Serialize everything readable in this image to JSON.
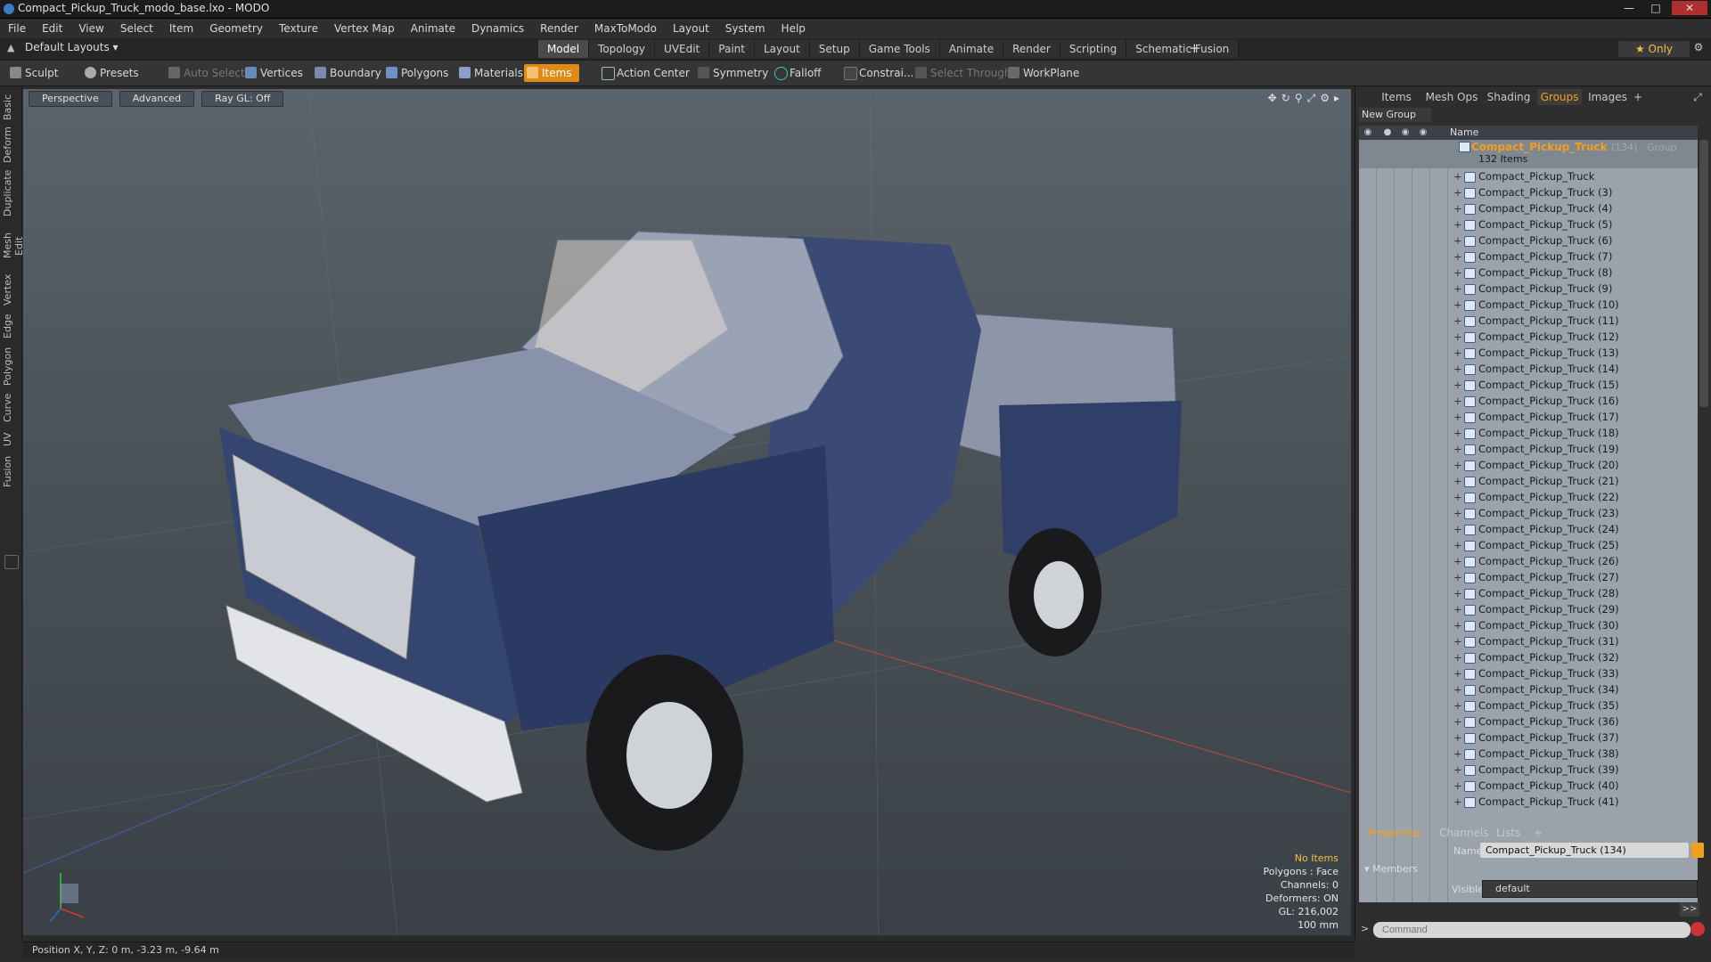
{
  "window": {
    "title": "Compact_Pickup_Truck_modo_base.lxo - MODO"
  },
  "menu": [
    "File",
    "Edit",
    "View",
    "Select",
    "Item",
    "Geometry",
    "Texture",
    "Vertex Map",
    "Animate",
    "Dynamics",
    "Render",
    "MaxToModo",
    "Layout",
    "System",
    "Help"
  ],
  "layouts": {
    "label": "Default Layouts ▾"
  },
  "tabs": [
    "Model",
    "Topology",
    "UVEdit",
    "Paint",
    "Layout",
    "Setup",
    "Game Tools",
    "Animate",
    "Render",
    "Scripting",
    "Schematic Fusion"
  ],
  "only_label": "★ Only",
  "toolbar": {
    "sculpt": "Sculpt",
    "presets": "Presets",
    "auto_select": "Auto Select",
    "vertices": "Vertices",
    "boundary": "Boundary",
    "polygons": "Polygons",
    "materials": "Materials",
    "items": "Items",
    "action_center": "Action Center",
    "symmetry": "Symmetry",
    "falloff": "Falloff",
    "constraints": "Constrai...",
    "select_through": "Select Through",
    "workplane": "WorkPlane"
  },
  "side_tabs": [
    "Basic",
    "Deform",
    "Duplicate",
    "Mesh Edit",
    "Vertex",
    "Edge",
    "Polygon",
    "Curve",
    "UV",
    "Fusion"
  ],
  "viewport": {
    "perspective": "Perspective",
    "advanced": "Advanced",
    "raygl": "Ray GL: Off",
    "hud": {
      "items": "No Items",
      "polygons": "Polygons : Face",
      "channels": "Channels: 0",
      "deformers": "Deformers: ON",
      "gl": "GL: 216,002",
      "unit": "100 mm"
    }
  },
  "panel_tabs": [
    "Items",
    "Mesh Ops",
    "Shading",
    "Groups",
    "Images"
  ],
  "new_group": "New Group",
  "tree_header": "Name",
  "group": {
    "name": "Compact_Pickup_Truck",
    "suffix": "(134) : Group",
    "count": "132 Items"
  },
  "tree_items": [
    "Compact_Pickup_Truck",
    "Compact_Pickup_Truck (3)",
    "Compact_Pickup_Truck (4)",
    "Compact_Pickup_Truck (5)",
    "Compact_Pickup_Truck (6)",
    "Compact_Pickup_Truck (7)",
    "Compact_Pickup_Truck (8)",
    "Compact_Pickup_Truck (9)",
    "Compact_Pickup_Truck (10)",
    "Compact_Pickup_Truck (11)",
    "Compact_Pickup_Truck (12)",
    "Compact_Pickup_Truck (13)",
    "Compact_Pickup_Truck (14)",
    "Compact_Pickup_Truck (15)",
    "Compact_Pickup_Truck (16)",
    "Compact_Pickup_Truck (17)",
    "Compact_Pickup_Truck (18)",
    "Compact_Pickup_Truck (19)",
    "Compact_Pickup_Truck (20)",
    "Compact_Pickup_Truck (21)",
    "Compact_Pickup_Truck (22)",
    "Compact_Pickup_Truck (23)",
    "Compact_Pickup_Truck (24)",
    "Compact_Pickup_Truck (25)",
    "Compact_Pickup_Truck (26)",
    "Compact_Pickup_Truck (27)",
    "Compact_Pickup_Truck (28)",
    "Compact_Pickup_Truck (29)",
    "Compact_Pickup_Truck (30)",
    "Compact_Pickup_Truck (31)",
    "Compact_Pickup_Truck (32)",
    "Compact_Pickup_Truck (33)",
    "Compact_Pickup_Truck (34)",
    "Compact_Pickup_Truck (35)",
    "Compact_Pickup_Truck (36)",
    "Compact_Pickup_Truck (37)",
    "Compact_Pickup_Truck (38)",
    "Compact_Pickup_Truck (39)",
    "Compact_Pickup_Truck (40)",
    "Compact_Pickup_Truck (41)"
  ],
  "props": {
    "tabs": [
      "Properties",
      "Channels",
      "Lists"
    ],
    "name_label": "Name",
    "name_value": "Compact_Pickup_Truck (134)",
    "members": "Members",
    "visible_label": "Visible",
    "visible_value": "default",
    "more": ">>",
    "command_placeholder": "Command"
  },
  "status": {
    "position": "Position X, Y, Z:  0 m, -3.23 m, -9.64 m"
  },
  "colors": {
    "accent": "#f0a020",
    "items_tab": "#e08a18",
    "body_blue": "#2a3a62"
  }
}
